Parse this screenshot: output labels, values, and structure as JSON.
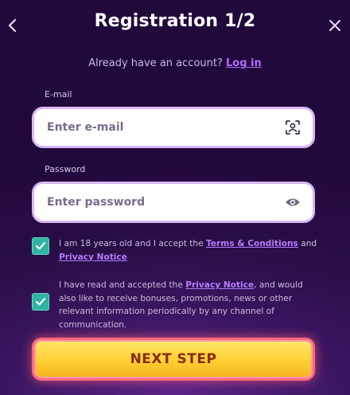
{
  "header": {
    "title": "Registration 1/2",
    "back_icon": "chevron-left-icon",
    "close_icon": "close-icon"
  },
  "login_prompt": {
    "text": "Already have an account?",
    "link": "Log in"
  },
  "email": {
    "label": "E-mail",
    "placeholder": "Enter e-mail",
    "icon": "face-scan-icon"
  },
  "password": {
    "label": "Password",
    "placeholder": "Enter password",
    "icon": "eye-icon"
  },
  "consent_age": {
    "checked": true,
    "text_before": "I am 18 years old and I accept the",
    "link1": "Terms & Conditions",
    "text_mid": "and",
    "link2": "Privacy Notice"
  },
  "consent_marketing": {
    "checked": true,
    "text_before": "I have read and accepted the",
    "link": "Privacy Notice",
    "text_after": ", and would also like to receive bonuses, promotions, news or other relevant information periodically by any channel of communication."
  },
  "next_button": {
    "label": "NEXT STEP"
  },
  "colors": {
    "accent_link": "#b06cff",
    "checkbox": "#2fb3a2",
    "button_fill": "#ffcf33",
    "button_border": "#ff6a7a",
    "background": "#2a0f49"
  }
}
